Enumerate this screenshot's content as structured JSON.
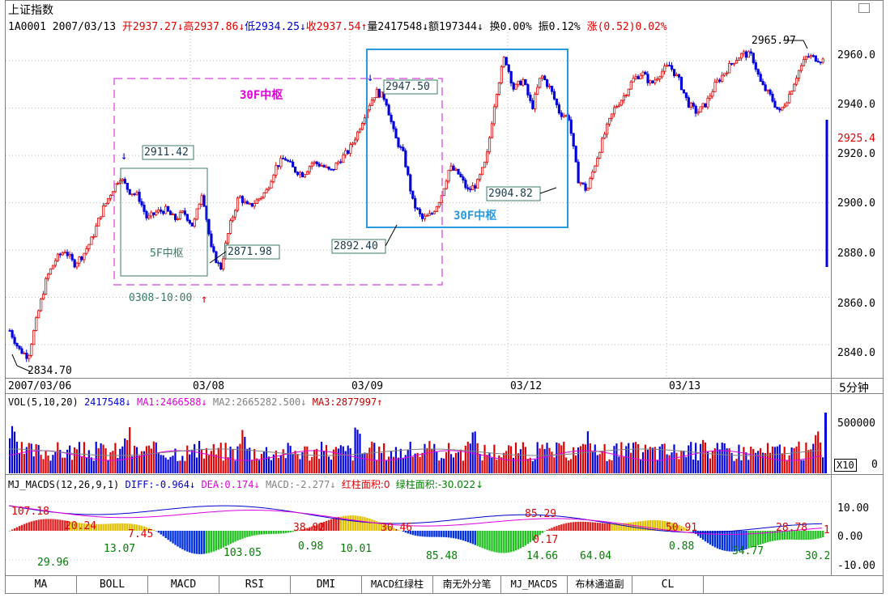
{
  "header": {
    "title": "上证指数",
    "code": "1A0001",
    "date": "2007/03/13",
    "open": "开2937.27↓",
    "high": "高2937.86↓",
    "low": "低2934.25↓",
    "close": "收2937.54↑",
    "volume": "量2417548↓",
    "amount": "额197344↓",
    "turnover": "换0.00%",
    "amplitude": "振0.12%",
    "change": "涨(0.52)0.02%"
  },
  "price_axis": {
    "labels": [
      "2960.0",
      "2940.0",
      "2920.0",
      "2900.0",
      "2880.0",
      "2860.0",
      "2840.0"
    ],
    "current": "2925.4",
    "period": "5分钟"
  },
  "date_axis": {
    "labels": [
      "2007/03/06",
      "03/08",
      "03/09",
      "03/12",
      "03/13"
    ]
  },
  "annotations": {
    "low_start": "2834.70",
    "hi1": "2911.42",
    "lo1": "2871.98",
    "hi2": "2947.50",
    "lo2": "2892.40",
    "lo3": "2904.82",
    "hi3": "2965.97",
    "box_5f": "5F中枢",
    "box_30f_a": "30F中枢",
    "box_30f_b": "30F中枢",
    "time_mark": "0308-10:00"
  },
  "vol_panel": {
    "title": "VOL(5,10,20)",
    "v": "2417548↓",
    "ma1": "MA1:2466588↓",
    "ma2": "MA2:2665282.500↓",
    "ma3": "MA3:2877997↑",
    "axis_top": "500000",
    "axis_zero": "0",
    "unit": "X10"
  },
  "macd_panel": {
    "title": "MJ_MACDS(12,26,9,1)",
    "diff": "DIFF:-0.964↓",
    "dea": "DEA:0.174↓",
    "macd": "MACD:-2.277↓",
    "red_area": "红柱面积:0",
    "green_area": "绿柱面积:-30.022↓",
    "axis": [
      "10.00",
      "0.00",
      "-10.00"
    ],
    "red_labels": [
      "107.18",
      "20.24",
      "7.45",
      "38.92",
      "30.46",
      "85.29",
      "0.17",
      "50.91",
      "28.78",
      "1"
    ],
    "green_labels": [
      "29.96",
      "13.07",
      "103.05",
      "0.98",
      "10.01",
      "85.48",
      "14.66",
      "64.04",
      "0.88",
      "34.77",
      "30.2"
    ]
  },
  "tabs": [
    "MA",
    "BOLL",
    "MACD",
    "RSI",
    "DMI",
    "MACD红绿柱",
    "南无外分笔",
    "MJ_MACDS",
    "布林通道副",
    "CL",
    ""
  ],
  "chart_data": {
    "type": "candlestick",
    "period": "5分钟",
    "ylim": [
      2826,
      2972
    ],
    "x": [
      "2007/03/06",
      "03/08",
      "03/09",
      "03/12",
      "03/13"
    ],
    "close_path": [
      [
        0,
        2846
      ],
      [
        4,
        2838
      ],
      [
        8,
        2835
      ],
      [
        12,
        2852
      ],
      [
        16,
        2868
      ],
      [
        20,
        2876
      ],
      [
        24,
        2880
      ],
      [
        28,
        2874
      ],
      [
        32,
        2878
      ],
      [
        36,
        2885
      ],
      [
        40,
        2896
      ],
      [
        44,
        2904
      ],
      [
        48,
        2911
      ],
      [
        52,
        2905
      ],
      [
        56,
        2903
      ],
      [
        60,
        2893
      ],
      [
        64,
        2896
      ],
      [
        68,
        2897
      ],
      [
        72,
        2893
      ],
      [
        76,
        2896
      ],
      [
        80,
        2890
      ],
      [
        84,
        2905
      ],
      [
        88,
        2880
      ],
      [
        92,
        2872
      ],
      [
        96,
        2890
      ],
      [
        100,
        2903
      ],
      [
        104,
        2898
      ],
      [
        108,
        2901
      ],
      [
        112,
        2905
      ],
      [
        116,
        2915
      ],
      [
        120,
        2919
      ],
      [
        124,
        2914
      ],
      [
        128,
        2912
      ],
      [
        132,
        2917
      ],
      [
        136,
        2916
      ],
      [
        140,
        2913
      ],
      [
        144,
        2918
      ],
      [
        148,
        2922
      ],
      [
        152,
        2930
      ],
      [
        156,
        2940
      ],
      [
        160,
        2947
      ],
      [
        164,
        2944
      ],
      [
        168,
        2928
      ],
      [
        172,
        2920
      ],
      [
        176,
        2900
      ],
      [
        180,
        2893
      ],
      [
        184,
        2895
      ],
      [
        188,
        2902
      ],
      [
        192,
        2915
      ],
      [
        196,
        2912
      ],
      [
        200,
        2905
      ],
      [
        204,
        2908
      ],
      [
        208,
        2918
      ],
      [
        212,
        2945
      ],
      [
        216,
        2962
      ],
      [
        220,
        2948
      ],
      [
        224,
        2952
      ],
      [
        228,
        2940
      ],
      [
        232,
        2954
      ],
      [
        236,
        2948
      ],
      [
        240,
        2938
      ],
      [
        244,
        2936
      ],
      [
        248,
        2910
      ],
      [
        252,
        2905
      ],
      [
        256,
        2918
      ],
      [
        260,
        2930
      ],
      [
        264,
        2940
      ],
      [
        268,
        2945
      ],
      [
        272,
        2952
      ],
      [
        276,
        2955
      ],
      [
        280,
        2950
      ],
      [
        284,
        2955
      ],
      [
        288,
        2958
      ],
      [
        292,
        2952
      ],
      [
        296,
        2942
      ],
      [
        300,
        2938
      ],
      [
        304,
        2942
      ],
      [
        308,
        2950
      ],
      [
        312,
        2955
      ],
      [
        316,
        2960
      ],
      [
        320,
        2963
      ],
      [
        324,
        2962
      ],
      [
        328,
        2950
      ],
      [
        332,
        2945
      ],
      [
        336,
        2938
      ],
      [
        340,
        2945
      ],
      [
        344,
        2955
      ],
      [
        348,
        2962
      ],
      [
        352,
        2961
      ],
      [
        356,
        2960
      ]
    ],
    "volume_label": "2417548",
    "macd": {
      "diff": -0.964,
      "dea": 0.174,
      "macd": -2.277
    }
  }
}
